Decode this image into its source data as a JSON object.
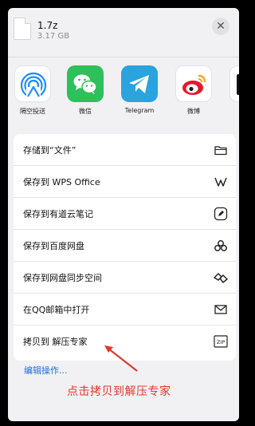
{
  "file": {
    "name": "1.7z",
    "size": "3.17 GB"
  },
  "close_glyph": "✕",
  "apps": [
    {
      "label": "隔空投送",
      "icon": "airdrop-icon"
    },
    {
      "label": "微信",
      "icon": "wechat-icon"
    },
    {
      "label": "Telegram",
      "icon": "telegram-icon"
    },
    {
      "label": "微博",
      "icon": "weibo-icon"
    }
  ],
  "actions": [
    {
      "label": "存储到“文件”",
      "icon": "folder-icon"
    },
    {
      "label": "保存到 WPS Office",
      "icon": "wps-icon"
    },
    {
      "label": "保存到有道云笔记",
      "icon": "youdao-note-icon"
    },
    {
      "label": "保存到百度网盘",
      "icon": "baidu-netdisk-icon"
    },
    {
      "label": "保存到网盘同步空间",
      "icon": "sync-space-icon"
    },
    {
      "label": "在QQ邮箱中打开",
      "icon": "mail-icon"
    },
    {
      "label": "拷贝到 解压专家",
      "icon": "zip-icon",
      "icon_text": "ZIP"
    }
  ],
  "edit_actions": "编辑操作...",
  "annotation": "点击拷贝到解压专家",
  "colors": {
    "sheet_bg": "#f1f1f3",
    "accent_blue": "#1f6fe0",
    "annotation_red": "#e03a2c",
    "wechat_green": "#2ec05a",
    "telegram_blue": "#2aa3df"
  }
}
